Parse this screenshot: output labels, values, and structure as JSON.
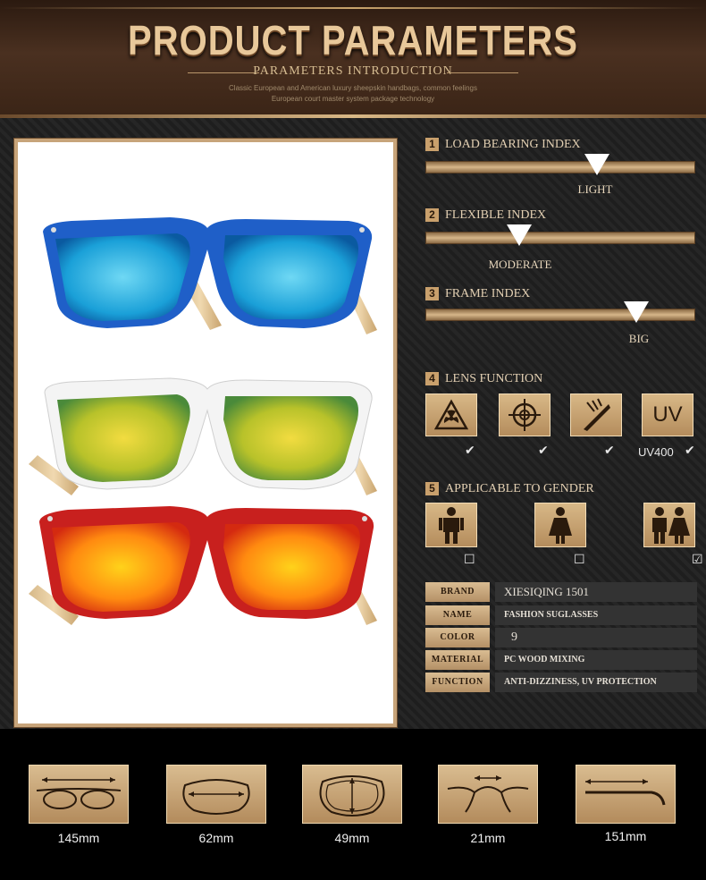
{
  "header": {
    "title": "PRODUCT PARAMETERS",
    "subtitle": "PARAMETERS INTRODUCTION",
    "line1": "Classic European and American luxury sheepskin handbags, common feelings",
    "line2": "European court master system package technology"
  },
  "sections": [
    {
      "num": "1",
      "label": "LOAD BEARING INDEX",
      "value": "LIGHT",
      "level": 0.63
    },
    {
      "num": "2",
      "label": "FLEXIBLE INDEX",
      "value": "MODERATE",
      "level": 0.35
    },
    {
      "num": "3",
      "label": "FRAME INDEX",
      "value": "BIG",
      "level": 0.78
    }
  ],
  "lens": {
    "num": "4",
    "label": "LENS FUNCTION",
    "icons": [
      "radiation-icon",
      "crosshair-icon",
      "glare-icon",
      "uv-icon"
    ],
    "uv_text": "UV",
    "uv400": "UV400",
    "checks": [
      "✔",
      "✔",
      "✔",
      "✔"
    ]
  },
  "gender": {
    "num": "5",
    "label": "APPLICABLE TO GENDER",
    "icons": [
      "male-icon",
      "female-icon",
      "couple-icon"
    ],
    "checks": [
      "☐",
      "☐",
      "☑"
    ]
  },
  "specs": [
    {
      "key": "BRAND",
      "value": "XIESIQING 1501"
    },
    {
      "key": "NAME",
      "value": "FASHION SUGLASSES"
    },
    {
      "key": "COLOR",
      "value": "9"
    },
    {
      "key": "MATERIAL",
      "value": "PC WOOD MIXING"
    },
    {
      "key": "FUNCTION",
      "value": "ANTI-DIZZINESS, UV PROTECTION"
    }
  ],
  "dimensions": [
    {
      "icon": "frame-width-icon",
      "value": "145mm"
    },
    {
      "icon": "lens-width-icon",
      "value": "62mm"
    },
    {
      "icon": "lens-height-icon",
      "value": "49mm"
    },
    {
      "icon": "bridge-width-icon",
      "value": "21mm"
    },
    {
      "icon": "temple-length-icon",
      "value": "151mm"
    }
  ],
  "colors": {
    "gold": "#c9a06c",
    "frame1": "#1f5fc8",
    "frame2": "#f4f4f4",
    "frame3": "#c8201e"
  }
}
